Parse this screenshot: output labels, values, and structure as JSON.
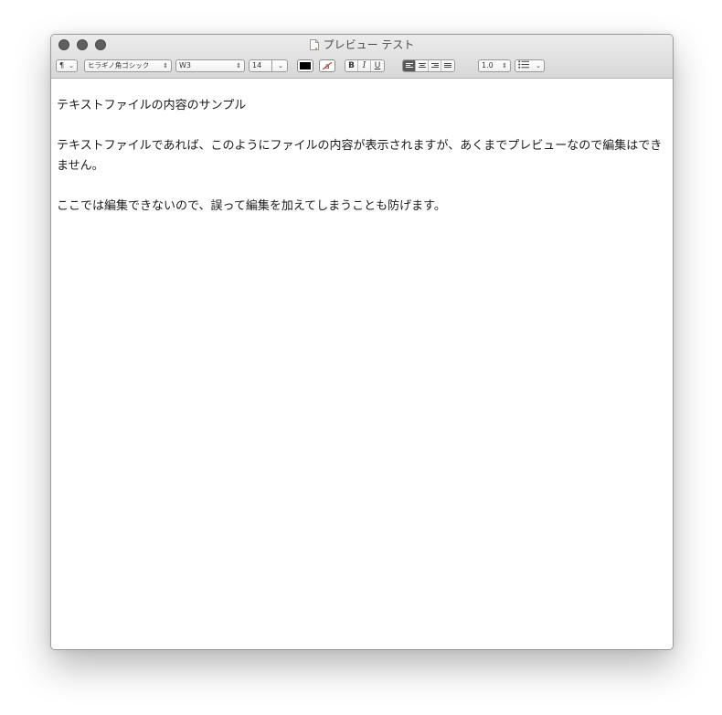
{
  "window": {
    "title": "プレビュー テスト",
    "doc_icon": "text-document-icon"
  },
  "toolbar": {
    "paragraph_style": "¶",
    "font_family": "ヒラギノ角ゴシック",
    "font_weight": "W3",
    "font_size": "14",
    "text_color": "#000000",
    "background_color_icon": "highlight-none-icon",
    "bold": "B",
    "italic": "I",
    "underline": "U",
    "line_spacing": "1.0",
    "list_icon": "list-bullets-icon"
  },
  "document": {
    "paragraphs": [
      "テキストファイルの内容のサンプル",
      "テキストファイルであれば、このようにファイルの内容が表示されますが、あくまでプレビューなので編集はできません。",
      "ここでは編集できないので、誤って編集を加えてしまうことも防げます。"
    ]
  }
}
